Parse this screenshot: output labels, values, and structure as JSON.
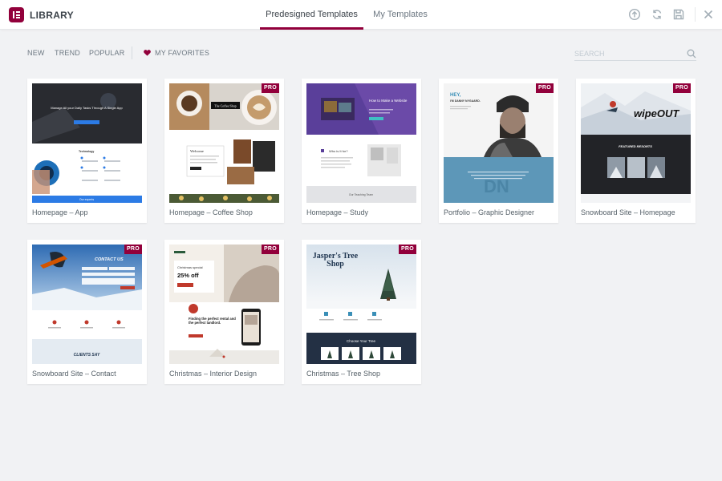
{
  "header": {
    "app_title": "LIBRARY",
    "tabs": [
      {
        "label": "Predesigned Templates",
        "active": true
      },
      {
        "label": "My Templates",
        "active": false
      }
    ]
  },
  "filters": {
    "items": [
      "NEW",
      "TREND",
      "POPULAR"
    ],
    "favorites_label": "MY FAVORITES",
    "search_placeholder": "SEARCH"
  },
  "pro_label": "PRO",
  "colors": {
    "brand": "#92003b",
    "background": "#f1f2f4",
    "text": "#556068"
  },
  "templates": [
    {
      "title": "Homepage – App",
      "pro": false,
      "hero": "Manage All your Daily Tasks Through A Single App",
      "section": "Technology",
      "footer": "Our experts"
    },
    {
      "title": "Homepage – Coffee Shop",
      "pro": true,
      "hero": "The Coffee Shop",
      "section": "Welcome"
    },
    {
      "title": "Homepage – Study",
      "pro": false,
      "hero": "How to Make a Website",
      "section": "Who is It for?",
      "footer": "Our Teaching Team"
    },
    {
      "title": "Portfolio – Graphic Designer",
      "pro": true,
      "hero": "HEY,",
      "subhero": "I'M DANNY NYGAARD."
    },
    {
      "title": "Snowboard Site – Homepage",
      "pro": true,
      "hero": "wipeOUT",
      "section": "FEATURED RESORTS"
    },
    {
      "title": "Snowboard Site – Contact",
      "pro": true,
      "hero": "CONTACT US",
      "footer": "CLIENTS SAY"
    },
    {
      "title": "Christmas – Interior Design",
      "pro": true,
      "hero": "Christmas special",
      "offer": "25% off",
      "section": "Finding the perfect rental and the perfect landlord."
    },
    {
      "title": "Christmas – Tree Shop",
      "pro": true,
      "hero": "Jasper's Tree Shop",
      "section": "Choose Your Tree"
    }
  ]
}
